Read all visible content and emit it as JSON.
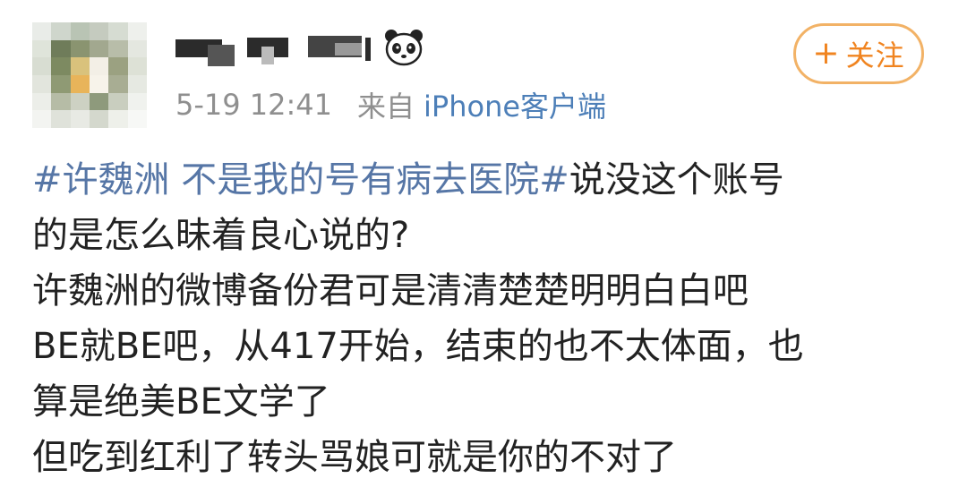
{
  "post": {
    "timestamp": "5-19 12:41",
    "source_prefix": "来自",
    "source_device": "iPhone客户端",
    "follow_button": {
      "plus": "+",
      "label": "关注"
    },
    "topic": "#许魏洲 不是我的号有病去医院#",
    "line1_rest": "说没这个账号",
    "lines": [
      "的是怎么昧着良心说的?",
      "许魏洲的微博备份君可是清清楚楚明明白白吧",
      "BE就BE吧，从417开始，结束的也不太体面，也",
      "算是绝美BE文学了",
      "但吃到红利了转头骂娘可就是你的不对了"
    ]
  },
  "author": {
    "name_redacted": true,
    "badge_icon": "panda-icon"
  },
  "colors": {
    "topic_link": "#5676a6",
    "source_link": "#4d7fb8",
    "follow_orange": "#f08420",
    "follow_border": "#f2b266",
    "meta_gray": "#8f8f8f"
  }
}
